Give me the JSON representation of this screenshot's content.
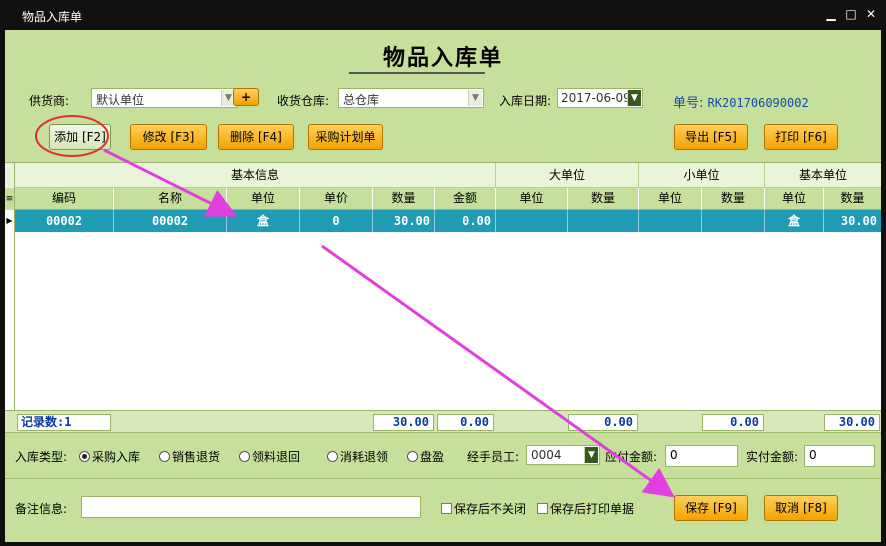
{
  "window": {
    "title": "物品入库单",
    "minimize_glyph": "▁",
    "maximize_glyph": "□",
    "close_glyph": "✕"
  },
  "header": {
    "title": "物品入库单",
    "supplier_label": "供货商:",
    "supplier_value": "默认单位",
    "add_supplier_glyph": "+",
    "warehouse_label": "收货仓库:",
    "warehouse_value": "总仓库",
    "date_label": "入库日期:",
    "date_value": "2017-06-09",
    "order_no_label": "单号:",
    "order_no_value": "RK201706090002"
  },
  "toolbar": {
    "add": "添加 [F2]",
    "edit": "修改 [F3]",
    "delete": "删除 [F4]",
    "purchase_plan": "采购计划单",
    "export": "导出 [F5]",
    "print": "打印 [F6]"
  },
  "grid": {
    "groups": [
      "基本信息",
      "大单位",
      "小单位",
      "基本单位"
    ],
    "columns": [
      "编码",
      "名称",
      "单位",
      "单价",
      "数量",
      "金额",
      "单位",
      "数量",
      "单位",
      "数量",
      "单位",
      "数量"
    ],
    "rows": [
      [
        "00002",
        "00002",
        "盒",
        "0",
        "30.00",
        "0.00",
        "",
        "",
        "",
        "",
        "盒",
        "30.00"
      ]
    ],
    "footer": {
      "record_count": "记录数:1",
      "qty_total": "30.00",
      "amount_total": "0.00",
      "big_qty": "0.00",
      "small_qty": "0.00",
      "base_qty": "30.00"
    }
  },
  "form": {
    "type_label": "入库类型:",
    "types": [
      "采购入库",
      "销售退货",
      "领料退回",
      "消耗退领",
      "盘盈"
    ],
    "selected_type": "采购入库",
    "handler_label": "经手员工:",
    "handler_value": "0004",
    "payable_label": "应付金额:",
    "payable_value": "0",
    "paid_label": "实付金额:",
    "paid_value": "0",
    "remark_label": "备注信息:",
    "remark_value": "",
    "keep_open_label": "保存后不关闭",
    "print_after_save_label": "保存后打印单据",
    "save": "保存 [F9]",
    "cancel": "取消 [F8]"
  },
  "colors": {
    "background": "#c6df9a",
    "button": "#f5b21f",
    "selected_row": "#1f9bb3",
    "annotation": "#e040e0"
  },
  "icons": [
    "row-pointer-icon",
    "dropdown-arrow-icon",
    "radio-icon",
    "checkbox-icon"
  ]
}
